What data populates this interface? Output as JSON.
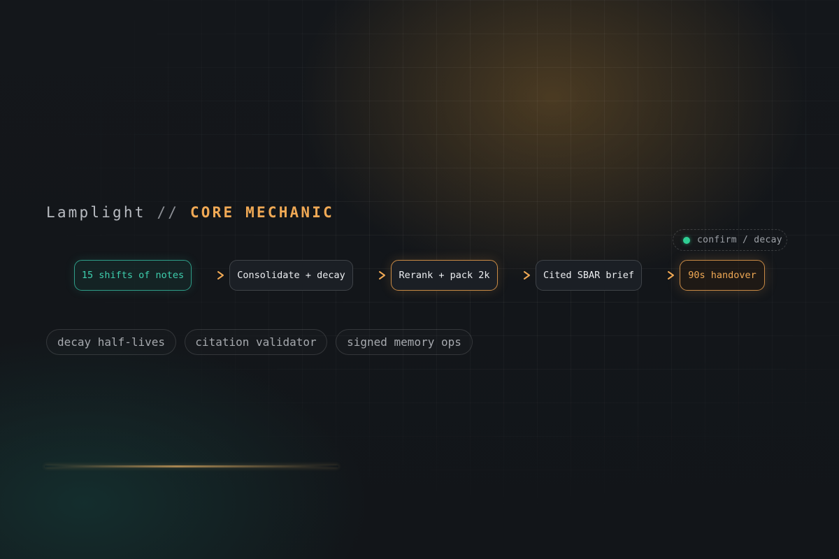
{
  "header": {
    "product": "Lamplight",
    "separator": "//",
    "section": "CORE MECHANIC"
  },
  "status": {
    "label": "confirm / decay",
    "dot_color": "#2fcf94"
  },
  "pipeline": {
    "steps": [
      {
        "label": "15 shifts of notes",
        "style": "teal"
      },
      {
        "label": "Consolidate + decay",
        "style": "neutral"
      },
      {
        "label": "Rerank + pack 2k",
        "style": "amber"
      },
      {
        "label": "Cited SBAR brief",
        "style": "neutral"
      },
      {
        "label": "90s handover",
        "style": "amber-text"
      }
    ]
  },
  "features": [
    "decay half-lives",
    "citation validator",
    "signed memory ops"
  ],
  "colors": {
    "accent_amber": "#f0a955",
    "accent_teal": "#3ecfae",
    "background": "#121519"
  }
}
